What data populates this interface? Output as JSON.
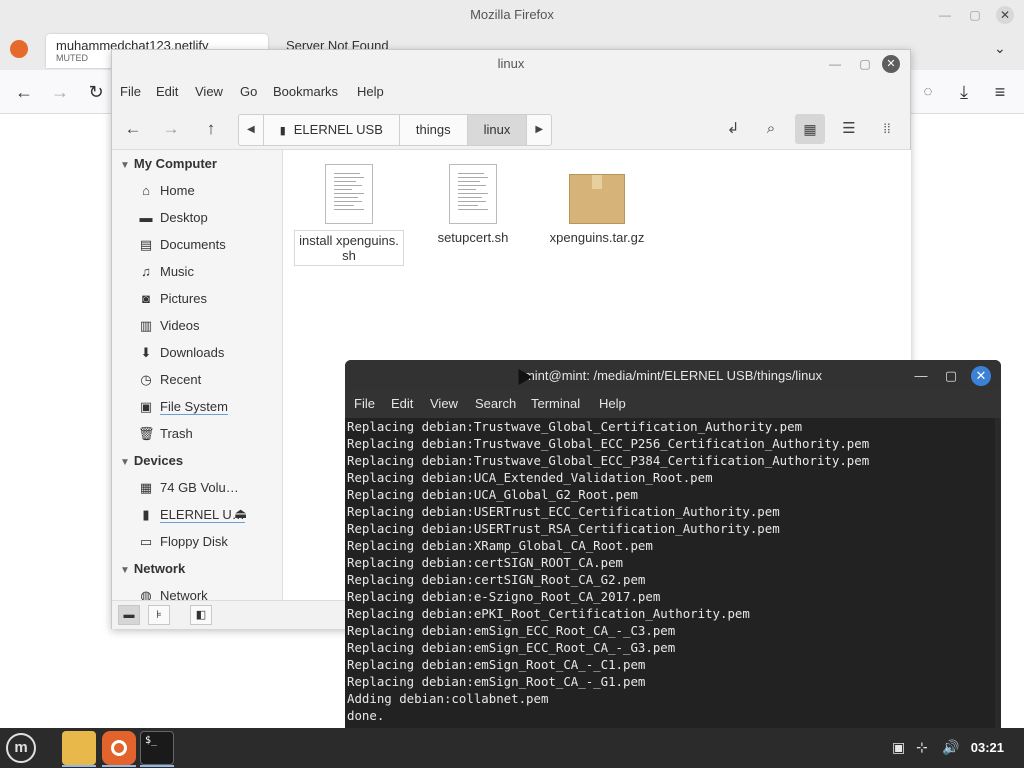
{
  "firefox": {
    "window_title": "Mozilla Firefox",
    "tab1_title": "muhammedchat123.netlify",
    "tab1_sub": "MUTED",
    "tab2_title": "Server Not Found"
  },
  "nemo": {
    "window_title": "linux",
    "menu": [
      "File",
      "Edit",
      "View",
      "Go",
      "Bookmarks",
      "Help"
    ],
    "path": [
      "ELERNEL USB",
      "things",
      "linux"
    ],
    "sidebar": {
      "my_computer": "My Computer",
      "items": [
        "Home",
        "Desktop",
        "Documents",
        "Music",
        "Pictures",
        "Videos",
        "Downloads",
        "Recent",
        "File System",
        "Trash"
      ],
      "devices": "Devices",
      "device_items": [
        "74 GB Volu…",
        "ELERNEL U…",
        "Floppy Disk"
      ],
      "network": "Network",
      "network_items": [
        "Network"
      ]
    },
    "files": [
      {
        "name": "install xpenguins.\nsh",
        "line1": "install xpenguins.",
        "line2": "sh"
      },
      {
        "name": "setupcert.sh"
      },
      {
        "name": "xpenguins.tar.gz"
      }
    ]
  },
  "terminal": {
    "title": "mint@mint: /media/mint/ELERNEL USB/things/linux",
    "menu": [
      "File",
      "Edit",
      "View",
      "Search",
      "Terminal",
      "Help"
    ],
    "lines": [
      "Replacing debian:Trustwave_Global_Certification_Authority.pem",
      "Replacing debian:Trustwave_Global_ECC_P256_Certification_Authority.pem",
      "Replacing debian:Trustwave_Global_ECC_P384_Certification_Authority.pem",
      "Replacing debian:UCA_Extended_Validation_Root.pem",
      "Replacing debian:UCA_Global_G2_Root.pem",
      "Replacing debian:USERTrust_ECC_Certification_Authority.pem",
      "Replacing debian:USERTrust_RSA_Certification_Authority.pem",
      "Replacing debian:XRamp_Global_CA_Root.pem",
      "Replacing debian:certSIGN_ROOT_CA.pem",
      "Replacing debian:certSIGN_Root_CA_G2.pem",
      "Replacing debian:e-Szigno_Root_CA_2017.pem",
      "Replacing debian:ePKI_Root_Certification_Authority.pem",
      "Replacing debian:emSign_ECC_Root_CA_-_C3.pem",
      "Replacing debian:emSign_ECC_Root_CA_-_G3.pem",
      "Replacing debian:emSign_Root_CA_-_C1.pem",
      "Replacing debian:emSign_Root_CA_-_G1.pem",
      "Adding debian:collabnet.pem",
      "done."
    ]
  },
  "taskbar": {
    "clock": "03:21"
  }
}
